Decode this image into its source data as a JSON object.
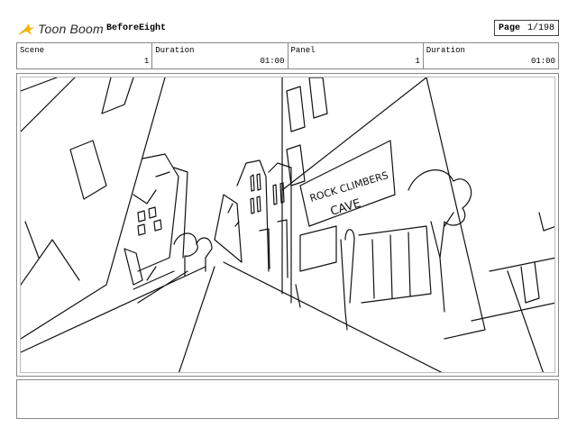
{
  "header": {
    "brand": "Toon Boom",
    "project": "BeforeEight",
    "page_label": "Page",
    "page_value": "1/198",
    "logo_icon": "toon-boom-logo-icon"
  },
  "info": {
    "scene_label": "Scene",
    "scene_value": "1",
    "duration1_label": "Duration",
    "duration1_value": "01:00",
    "panel_label": "Panel",
    "panel_value": "1",
    "duration2_label": "Duration",
    "duration2_value": "01:00"
  },
  "sketch": {
    "sign_line1": "ROCK CLIMBERS",
    "sign_line2": "CAVE"
  },
  "colors": {
    "logo_yellow": "#f2b705",
    "border": "#888888",
    "ink": "#111111"
  }
}
